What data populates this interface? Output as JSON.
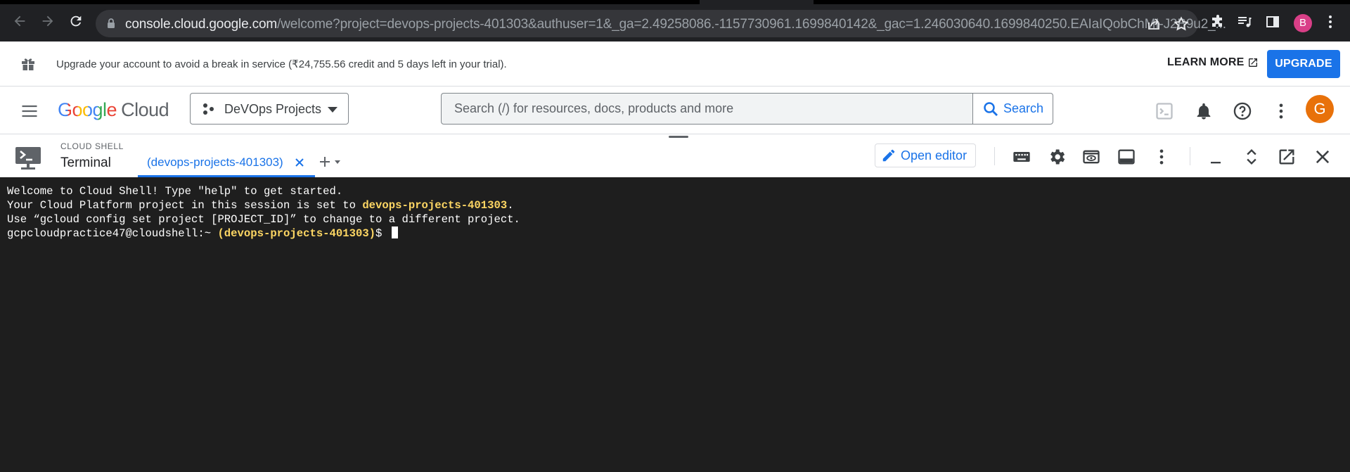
{
  "browser": {
    "url_host": "console.cloud.google.com",
    "url_rest": "/welcome?project=devops-projects-401303&authuser=1&_ga=2.49258086.-1157730961.1699840142&_gac=1.246030640.1699840250.EAIaIQobChMI-J2B9u2_...",
    "profile_initial": "B",
    "profile_color": "#d93f87"
  },
  "banner": {
    "text": "Upgrade your account to avoid a break in service (₹24,755.56 credit and 5 days left in your trial).",
    "learn_more": "LEARN MORE",
    "upgrade": "UPGRADE"
  },
  "header": {
    "logo_google": "Google",
    "logo_cloud": "Cloud",
    "project_name": "DeVOps Projects",
    "search_placeholder": "Search (/) for resources, docs, products and more",
    "search_button": "Search",
    "avatar_initial": "G",
    "avatar_color": "#e8710a"
  },
  "cloud_shell": {
    "label": "CLOUD SHELL",
    "title": "Terminal",
    "tab_label": "(devops-projects-401303)",
    "open_editor": "Open editor"
  },
  "terminal": {
    "line1": "Welcome to Cloud Shell! Type \"help\" to get started.",
    "line2_prefix": "Your Cloud Platform project in this session is set to ",
    "line2_project": "devops-projects-401303",
    "line2_suffix": ".",
    "line3": "Use “gcloud config set project [PROJECT_ID]” to change to a different project.",
    "prompt_user": "gcpcloudpractice47@cloudshell:~ ",
    "prompt_project": "(devops-projects-401303)",
    "prompt_symbol": "$ "
  },
  "colors": {
    "accent": "#1a73e8",
    "terminal_bg": "#1e1e1e",
    "terminal_highlight": "#fdd663"
  }
}
